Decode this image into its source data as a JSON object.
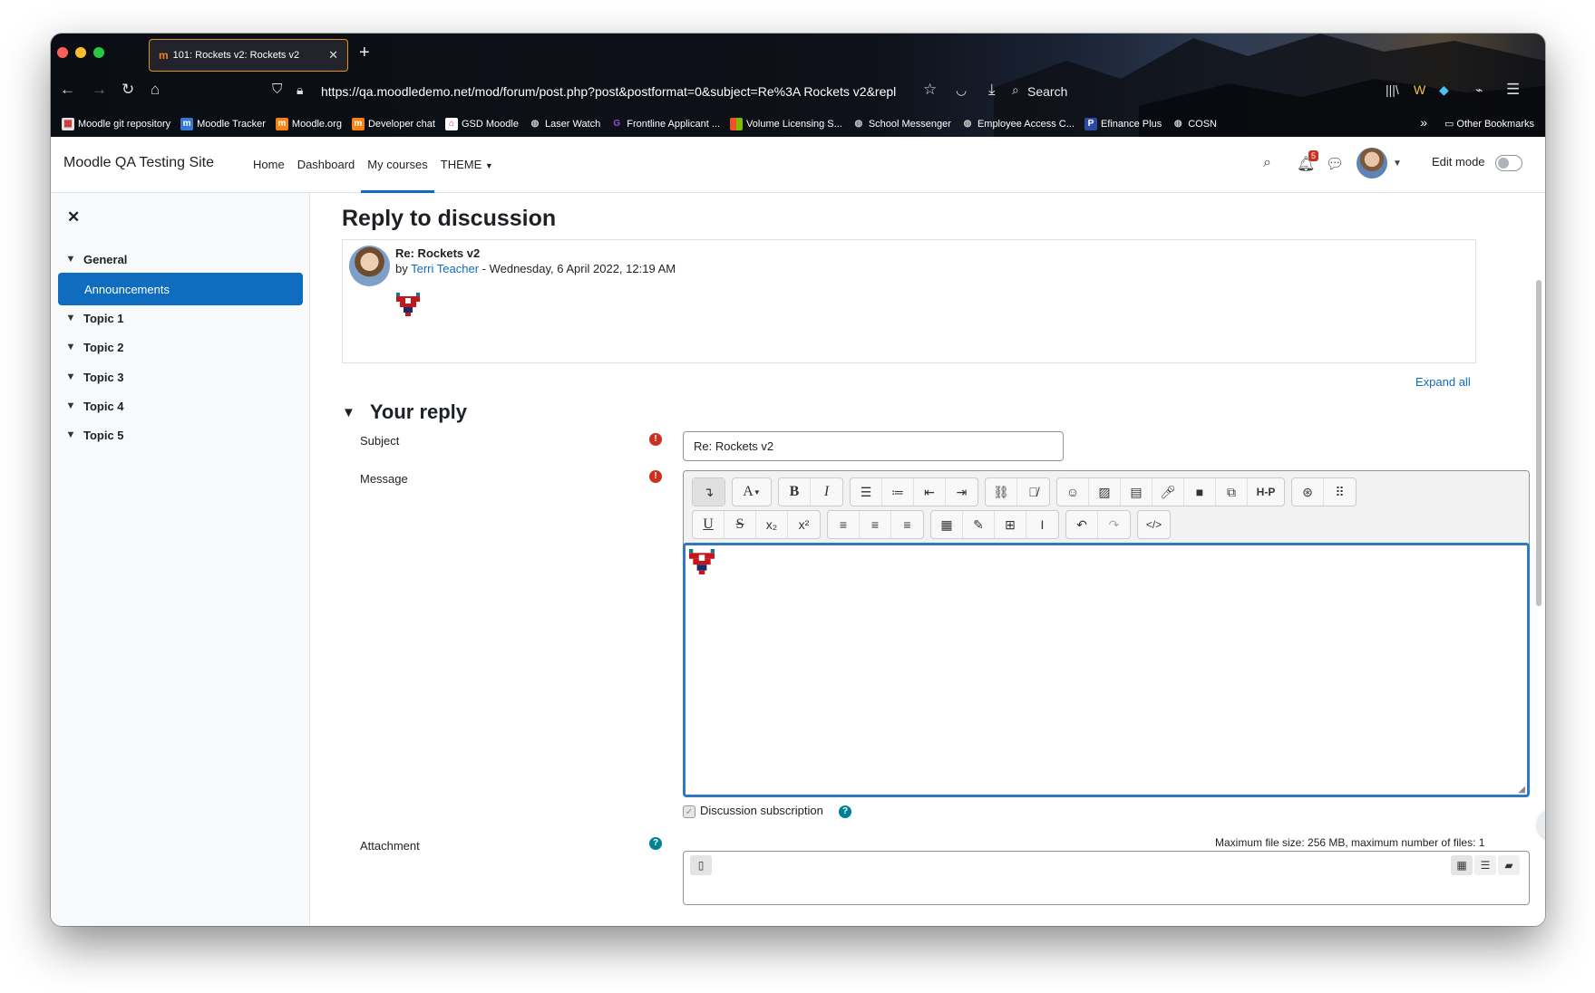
{
  "browser": {
    "tab_title": "101: Rockets v2: Rockets v2",
    "tab_icon": "m",
    "new_tab": "+",
    "close_tab": "✕",
    "url": "https://qa.moodledemo.net/mod/forum/post.php?post&postformat=0&subject=Re%3A Rockets v2&repl",
    "search_label": "Search",
    "bookmarks": [
      {
        "label": "Moodle git repository",
        "icon": "git",
        "color": "#e0e0e0"
      },
      {
        "label": "Moodle Tracker",
        "icon": "m",
        "color": "#3478d4"
      },
      {
        "label": "Moodle.org",
        "icon": "m",
        "color": "#f98012"
      },
      {
        "label": "Developer chat",
        "icon": "m",
        "color": "#f98012"
      },
      {
        "label": "GSD Moodle",
        "icon": "school",
        "color": "#c9302c"
      },
      {
        "label": "Laser Watch",
        "icon": "globe",
        "color": "#bbbbbb"
      },
      {
        "label": "Frontline Applicant ...",
        "icon": "g",
        "color": "#9b4dca"
      },
      {
        "label": "Volume Licensing S...",
        "icon": "ms",
        "color": "#f25022"
      },
      {
        "label": "School Messenger",
        "icon": "globe",
        "color": "#bbbbbb"
      },
      {
        "label": "Employee Access C...",
        "icon": "globe",
        "color": "#bbbbbb"
      },
      {
        "label": "Efinance Plus",
        "icon": "p",
        "color": "#2b4aa0"
      },
      {
        "label": "COSN",
        "icon": "globe",
        "color": "#bbbbbb"
      }
    ],
    "more_bookmarks": "»",
    "other_bookmarks": "Other Bookmarks"
  },
  "navbar": {
    "site_name": "Moodle QA Testing Site",
    "links": [
      "Home",
      "Dashboard",
      "My courses",
      "THEME"
    ],
    "active_link": "My courses",
    "notification_count": "5",
    "edit_mode_label": "Edit mode"
  },
  "drawer": {
    "items": [
      {
        "label": "General",
        "type": "section"
      },
      {
        "label": "Announcements",
        "type": "activity",
        "selected": true
      },
      {
        "label": "Topic 1",
        "type": "section"
      },
      {
        "label": "Topic 2",
        "type": "section"
      },
      {
        "label": "Topic 3",
        "type": "section"
      },
      {
        "label": "Topic 4",
        "type": "section"
      },
      {
        "label": "Topic 5",
        "type": "section"
      }
    ]
  },
  "page": {
    "title": "Reply to discussion",
    "post": {
      "subject": "Re: Rockets v2",
      "by_prefix": "by",
      "author": "Terri Teacher",
      "date": " - Wednesday, 6 April 2022, 12:19 AM"
    },
    "expand_all": "Expand all",
    "section_title": "Your reply",
    "form": {
      "subject_label": "Subject",
      "subject_value": "Re: Rockets v2",
      "message_label": "Message",
      "subscription_label": "Discussion subscription",
      "attachment_label": "Attachment",
      "max_file_info": "Maximum file size: 256 MB, maximum number of files: 1"
    },
    "help_button": "?"
  },
  "editor_toolbar": {
    "row1": [
      [
        "toggle-toolbar-icon"
      ],
      [
        "font-style-icon"
      ],
      [
        "bold-icon",
        "italic-icon"
      ],
      [
        "unordered-list-icon",
        "ordered-list-icon",
        "outdent-icon",
        "indent-icon"
      ],
      [
        "link-icon",
        "unlink-icon"
      ],
      [
        "emoji-icon",
        "image-icon",
        "media-icon",
        "record-audio-icon",
        "record-video-icon",
        "manage-files-icon",
        "h5p-icon"
      ],
      [
        "accessibility-checker-icon",
        "screenreader-helper-icon"
      ]
    ],
    "row2": [
      [
        "underline-icon",
        "strikethrough-icon",
        "subscript-icon",
        "superscript-icon"
      ],
      [
        "align-left-icon",
        "align-center-icon",
        "align-right-icon"
      ],
      [
        "equation-icon",
        "special-chars-icon",
        "table-icon",
        "clear-formatting-icon"
      ],
      [
        "undo-icon",
        "redo-icon"
      ],
      [
        "html-source-icon"
      ]
    ],
    "h5p_label": "H-P",
    "font_label": "A",
    "bold_label": "B",
    "italic_label": "I",
    "underline_label": "U",
    "strike_label": "S"
  },
  "colors": {
    "brand": "#0f6cbf",
    "required": "#ca3120",
    "help": "#008196",
    "focus_border": "#2f79c3"
  }
}
